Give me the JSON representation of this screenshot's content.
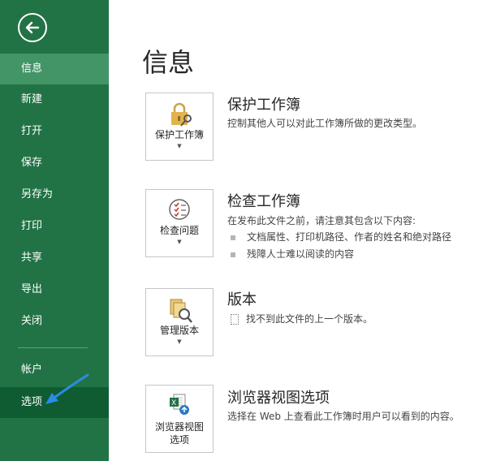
{
  "sidebar": {
    "items": [
      {
        "label": "信息"
      },
      {
        "label": "新建"
      },
      {
        "label": "打开"
      },
      {
        "label": "保存"
      },
      {
        "label": "另存为"
      },
      {
        "label": "打印"
      },
      {
        "label": "共享"
      },
      {
        "label": "导出"
      },
      {
        "label": "关闭"
      },
      {
        "label": "帐户"
      },
      {
        "label": "选项"
      }
    ],
    "colors": {
      "bg": "#217346",
      "active": "#439467",
      "selected": "#0f5c33"
    }
  },
  "main": {
    "title": "信息",
    "sections": [
      {
        "button": "保护工作簿",
        "title": "保护工作簿",
        "desc": "控制其他人可以对此工作簿所做的更改类型。",
        "icon": "lock-key-icon"
      },
      {
        "button": "检查问题",
        "title": "检查工作簿",
        "desc": "在发布此文件之前，请注意其包含以下内容:",
        "bullets": [
          "文档属性、打印机路径、作者的姓名和绝对路径",
          "残障人士难以阅读的内容"
        ],
        "icon": "checklist-icon"
      },
      {
        "button": "管理版本",
        "title": "版本",
        "desc": "找不到此文件的上一个版本。",
        "icon": "versions-search-icon"
      },
      {
        "button_line1": "浏览器视图",
        "button_line2": "选项",
        "title": "浏览器视图选项",
        "desc": "选择在 Web 上查看此工作簿时用户可以看到的内容。",
        "icon": "excel-web-icon"
      }
    ]
  },
  "annotation": {
    "arrow_color": "#2b8ce6"
  }
}
